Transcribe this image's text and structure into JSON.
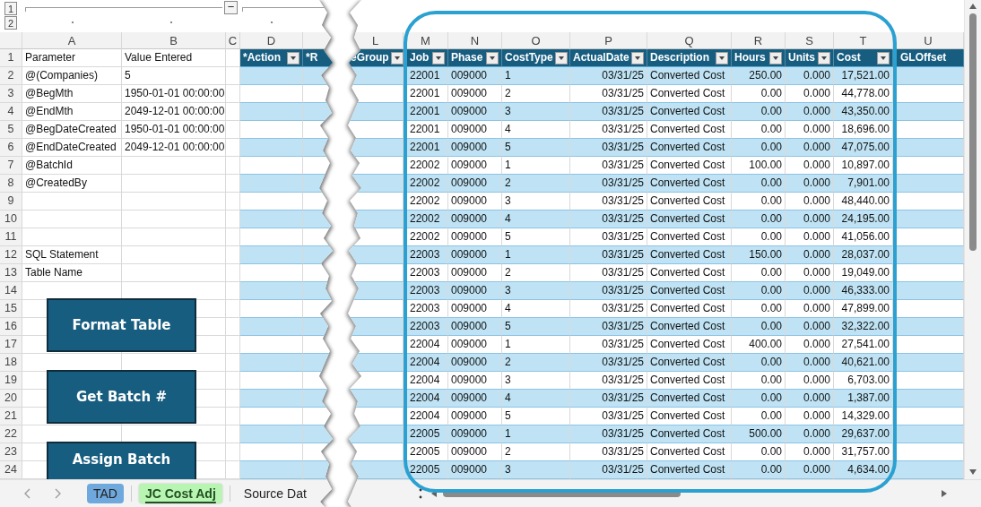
{
  "outline": {
    "levels": [
      "1",
      "2"
    ],
    "collapse_button": "−"
  },
  "left_sheet": {
    "column_letters": [
      "A",
      "B",
      "C",
      "D"
    ],
    "row_numbers": [
      "1",
      "2",
      "3",
      "4",
      "5",
      "6",
      "7",
      "8",
      "9",
      "10",
      "11",
      "12",
      "13",
      "14",
      "15",
      "16",
      "17",
      "18",
      "19",
      "20",
      "21",
      "22",
      "23",
      "24"
    ],
    "parameters": [
      {
        "name": "Parameter",
        "value": "Value Entered"
      },
      {
        "name": "@(Companies)",
        "value": "5"
      },
      {
        "name": "@BegMth",
        "value": "1950-01-01 00:00:00"
      },
      {
        "name": "@EndMth",
        "value": "2049-12-01 00:00:00"
      },
      {
        "name": "@BegDateCreated",
        "value": "1950-01-01 00:00:00"
      },
      {
        "name": "@EndDateCreated",
        "value": "2049-12-01 00:00:00"
      },
      {
        "name": "@BatchId"
      },
      {
        "name": "@CreatedBy"
      }
    ],
    "info_labels": [
      "SQL Statement",
      "Table Name"
    ],
    "table_headers": [
      {
        "label": "*Action",
        "filter": true
      },
      {
        "label": "*R",
        "filter": false
      }
    ],
    "buttons": [
      "Format Table",
      "Get Batch #",
      "Assign Batch"
    ]
  },
  "right_sheet": {
    "column_letters": [
      "L",
      "M",
      "N",
      "O",
      "P",
      "Q",
      "R",
      "S",
      "T",
      "U"
    ],
    "columns": [
      {
        "label": "eGroup",
        "kind": "text",
        "filter": true
      },
      {
        "label": "Job",
        "kind": "text",
        "filter": true
      },
      {
        "label": "Phase",
        "kind": "text",
        "filter": true
      },
      {
        "label": "CostType",
        "kind": "text",
        "filter": true
      },
      {
        "label": "ActualDate",
        "kind": "number",
        "filter": true
      },
      {
        "label": "Description",
        "kind": "text",
        "filter": true
      },
      {
        "label": "Hours",
        "kind": "number",
        "filter": true
      },
      {
        "label": "Units",
        "kind": "number",
        "filter": true
      },
      {
        "label": "Cost",
        "kind": "number",
        "filter": true
      },
      {
        "label": "GLOffset",
        "kind": "text",
        "filter": false
      }
    ],
    "rows": [
      [
        "",
        "22001",
        "009000",
        "1",
        "03/31/25",
        "Converted Cost",
        "250.00",
        "0.000",
        "17,521.00",
        ""
      ],
      [
        "",
        "22001",
        "009000",
        "2",
        "03/31/25",
        "Converted Cost",
        "0.00",
        "0.000",
        "44,778.00",
        ""
      ],
      [
        "",
        "22001",
        "009000",
        "3",
        "03/31/25",
        "Converted Cost",
        "0.00",
        "0.000",
        "43,350.00",
        ""
      ],
      [
        "",
        "22001",
        "009000",
        "4",
        "03/31/25",
        "Converted Cost",
        "0.00",
        "0.000",
        "18,696.00",
        ""
      ],
      [
        "",
        "22001",
        "009000",
        "5",
        "03/31/25",
        "Converted Cost",
        "0.00",
        "0.000",
        "47,075.00",
        ""
      ],
      [
        "",
        "22002",
        "009000",
        "1",
        "03/31/25",
        "Converted Cost",
        "100.00",
        "0.000",
        "10,897.00",
        ""
      ],
      [
        "",
        "22002",
        "009000",
        "2",
        "03/31/25",
        "Converted Cost",
        "0.00",
        "0.000",
        "7,901.00",
        ""
      ],
      [
        "",
        "22002",
        "009000",
        "3",
        "03/31/25",
        "Converted Cost",
        "0.00",
        "0.000",
        "48,440.00",
        ""
      ],
      [
        "",
        "22002",
        "009000",
        "4",
        "03/31/25",
        "Converted Cost",
        "0.00",
        "0.000",
        "24,195.00",
        ""
      ],
      [
        "",
        "22002",
        "009000",
        "5",
        "03/31/25",
        "Converted Cost",
        "0.00",
        "0.000",
        "41,056.00",
        ""
      ],
      [
        "",
        "22003",
        "009000",
        "1",
        "03/31/25",
        "Converted Cost",
        "150.00",
        "0.000",
        "28,037.00",
        ""
      ],
      [
        "",
        "22003",
        "009000",
        "2",
        "03/31/25",
        "Converted Cost",
        "0.00",
        "0.000",
        "19,049.00",
        ""
      ],
      [
        "",
        "22003",
        "009000",
        "3",
        "03/31/25",
        "Converted Cost",
        "0.00",
        "0.000",
        "46,333.00",
        ""
      ],
      [
        "",
        "22003",
        "009000",
        "4",
        "03/31/25",
        "Converted Cost",
        "0.00",
        "0.000",
        "47,899.00",
        ""
      ],
      [
        "",
        "22003",
        "009000",
        "5",
        "03/31/25",
        "Converted Cost",
        "0.00",
        "0.000",
        "32,322.00",
        ""
      ],
      [
        "",
        "22004",
        "009000",
        "1",
        "03/31/25",
        "Converted Cost",
        "400.00",
        "0.000",
        "27,541.00",
        ""
      ],
      [
        "",
        "22004",
        "009000",
        "2",
        "03/31/25",
        "Converted Cost",
        "0.00",
        "0.000",
        "40,621.00",
        ""
      ],
      [
        "",
        "22004",
        "009000",
        "3",
        "03/31/25",
        "Converted Cost",
        "0.00",
        "0.000",
        "6,703.00",
        ""
      ],
      [
        "",
        "22004",
        "009000",
        "4",
        "03/31/25",
        "Converted Cost",
        "0.00",
        "0.000",
        "1,387.00",
        ""
      ],
      [
        "",
        "22004",
        "009000",
        "5",
        "03/31/25",
        "Converted Cost",
        "0.00",
        "0.000",
        "14,329.00",
        ""
      ],
      [
        "",
        "22005",
        "009000",
        "1",
        "03/31/25",
        "Converted Cost",
        "500.00",
        "0.000",
        "29,637.00",
        ""
      ],
      [
        "",
        "22005",
        "009000",
        "2",
        "03/31/25",
        "Converted Cost",
        "0.00",
        "0.000",
        "31,757.00",
        ""
      ],
      [
        "",
        "22005",
        "009000",
        "3",
        "03/31/25",
        "Converted Cost",
        "0.00",
        "0.000",
        "4,634.00",
        ""
      ]
    ]
  },
  "sheet_tabs": [
    {
      "label": "TAD",
      "selected": false,
      "color": "#6fa8dc"
    },
    {
      "label": "JC Cost Adj",
      "selected": true,
      "color": "#b9f5b2"
    },
    {
      "label": "Source Dat",
      "selected": false
    }
  ]
}
